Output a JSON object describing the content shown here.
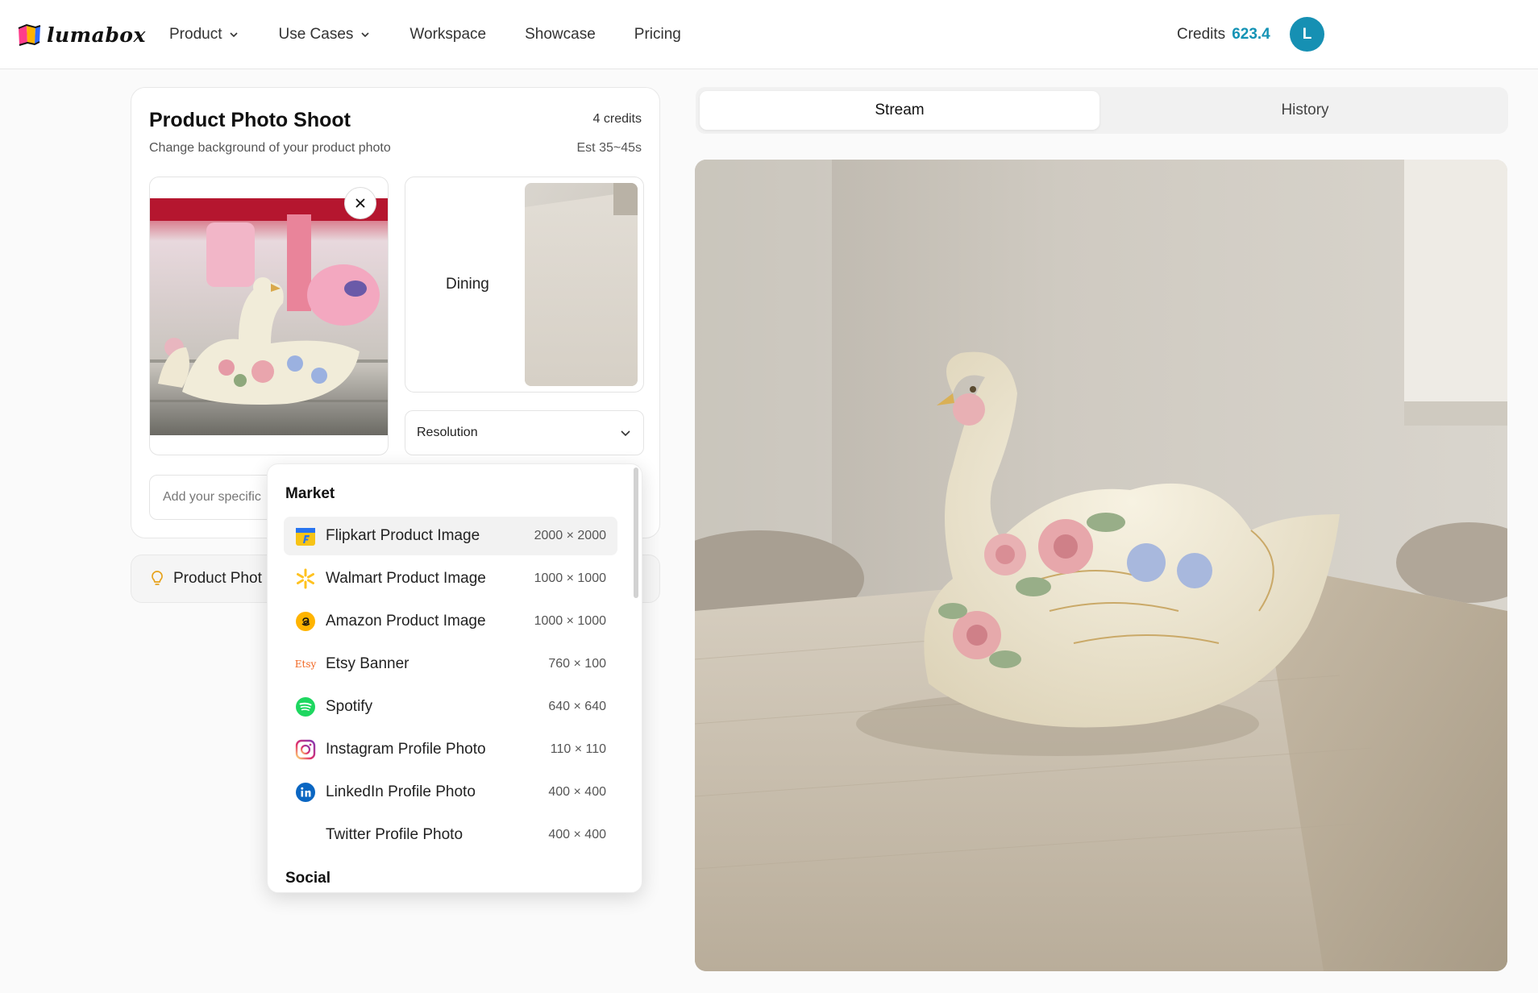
{
  "header": {
    "brand": "lumabox",
    "nav": [
      {
        "label": "Product",
        "has_dropdown": true
      },
      {
        "label": "Use Cases",
        "has_dropdown": true
      },
      {
        "label": "Workspace",
        "has_dropdown": false
      },
      {
        "label": "Showcase",
        "has_dropdown": false
      },
      {
        "label": "Pricing",
        "has_dropdown": false
      }
    ],
    "credits_label": "Credits",
    "credits_value": "623.4",
    "avatar_initial": "L"
  },
  "tool": {
    "title": "Product Photo Shoot",
    "subtitle": "Change background of your product photo",
    "cost": "4 credits",
    "estimate": "Est 35~45s",
    "scene_label": "Dining",
    "resolution_label": "Resolution",
    "prompt_placeholder": "Add your specific",
    "tip_label": "Product Phot"
  },
  "dropdown": {
    "sections": [
      {
        "title": "Market",
        "items": [
          {
            "label": "Flipkart Product Image",
            "size": "2000 × 2000",
            "icon": "flipkart-icon",
            "active": true
          },
          {
            "label": "Walmart Product Image",
            "size": "1000 × 1000",
            "icon": "walmart-icon"
          },
          {
            "label": "Amazon Product Image",
            "size": "1000 × 1000",
            "icon": "amazon-icon"
          },
          {
            "label": "Etsy Banner",
            "size": "760 × 100",
            "icon": "etsy-icon"
          },
          {
            "label": "Spotify",
            "size": "640 × 640",
            "icon": "spotify-icon"
          },
          {
            "label": "Instagram Profile Photo",
            "size": "110 × 110",
            "icon": "instagram-icon"
          },
          {
            "label": "LinkedIn Profile Photo",
            "size": "400 × 400",
            "icon": "linkedin-icon"
          },
          {
            "label": "Twitter Profile Photo",
            "size": "400 × 400",
            "icon": "twitter-icon"
          }
        ]
      },
      {
        "title": "Social",
        "items": []
      }
    ],
    "etsy_text": "Etsy"
  },
  "tabs": [
    {
      "label": "Stream",
      "active": true
    },
    {
      "label": "History",
      "active": false
    }
  ],
  "colors": {
    "accent": "#1493b5",
    "avatar_bg": "#1690b3"
  }
}
